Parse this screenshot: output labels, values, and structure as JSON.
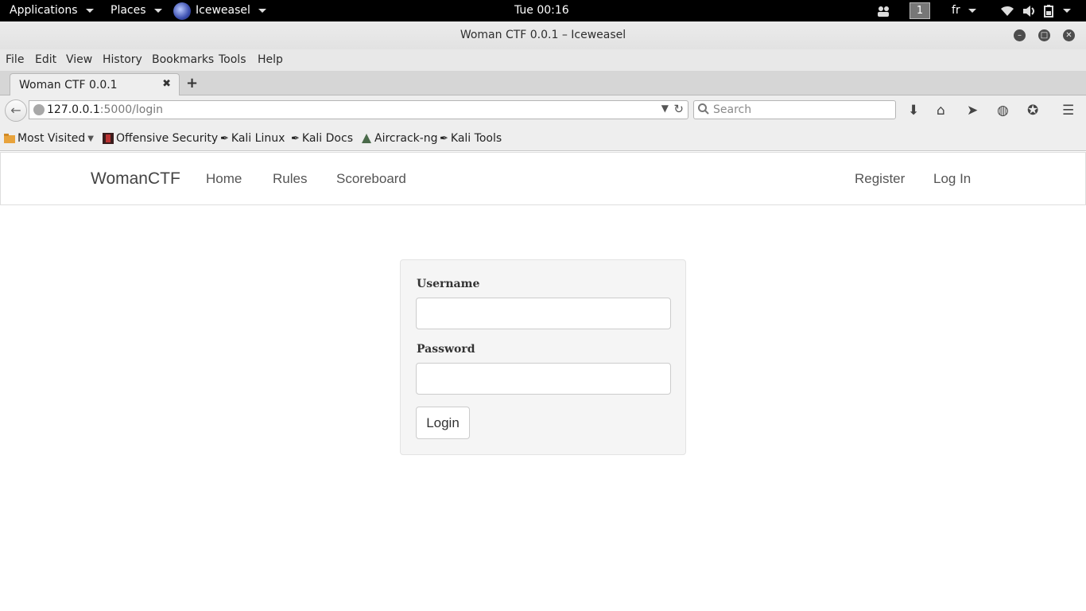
{
  "system_panel": {
    "applications_label": "Applications",
    "places_label": "Places",
    "active_app_label": "Iceweasel",
    "clock": "Tue 00:16",
    "workspace_number": "1",
    "keyboard_layout": "fr"
  },
  "window": {
    "title": "Woman CTF 0.0.1 – Iceweasel"
  },
  "menubar": {
    "items": [
      "File",
      "Edit",
      "View",
      "History",
      "Bookmarks",
      "Tools",
      "Help"
    ]
  },
  "tabs": [
    {
      "title": "Woman CTF 0.0.1",
      "active": true
    }
  ],
  "navbar": {
    "url_host": "127.0.0.1",
    "url_rest": ":5000/login",
    "search_placeholder": "Search"
  },
  "bookmarks": {
    "items": [
      {
        "label": "Most Visited",
        "icon": "folder-icon"
      },
      {
        "label": "Offensive Security",
        "icon": "offsec-icon"
      },
      {
        "label": "Kali Linux",
        "icon": "kali-icon"
      },
      {
        "label": "Kali Docs",
        "icon": "kali-icon"
      },
      {
        "label": "Aircrack-ng",
        "icon": "aircrack-icon"
      },
      {
        "label": "Kali Tools",
        "icon": "kali-icon"
      }
    ]
  },
  "site": {
    "brand": "WomanCTF",
    "nav_left": [
      "Home",
      "Rules",
      "Scoreboard"
    ],
    "nav_right": [
      "Register",
      "Log In"
    ],
    "login_form": {
      "username_label": "Username",
      "username_value": "",
      "password_label": "Password",
      "password_value": "",
      "submit_label": "Login"
    }
  },
  "colors": {
    "panel_bg": "#000000",
    "chrome_bg": "#eeeeee",
    "well_bg": "#f5f5f5"
  }
}
